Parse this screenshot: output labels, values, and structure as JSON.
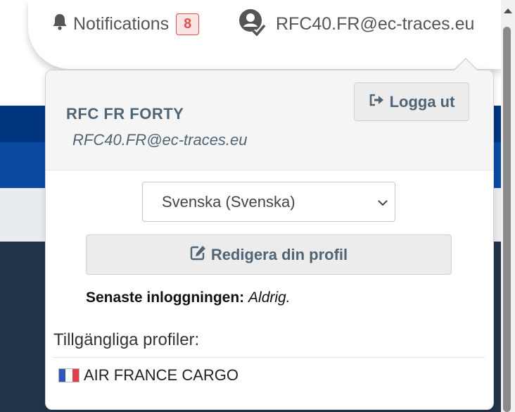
{
  "header": {
    "notifications_label": "Notifications",
    "notifications_count": "8",
    "user_email": "RFC40.FR@ec-traces.eu"
  },
  "panel": {
    "profile_name": "RFC FR FORTY",
    "profile_email": "RFC40.FR@ec-traces.eu",
    "logout_label": "Logga ut",
    "language_selected": "Svenska (Svenska)",
    "edit_profile_label": "Redigera din profil",
    "last_login_label": "Senaste inloggningen:",
    "last_login_value": "Aldrig.",
    "available_profiles_title": "Tillgängliga profiler:",
    "profiles": [
      {
        "name": "AIR FRANCE CARGO",
        "flag": "france-flag-icon"
      }
    ]
  },
  "colors": {
    "accent_text": "#4f6475",
    "badge_red": "#d9534f",
    "band_dark_blue": "#003580",
    "band_blue": "#0a4aa3",
    "band_dark": "#223447"
  }
}
